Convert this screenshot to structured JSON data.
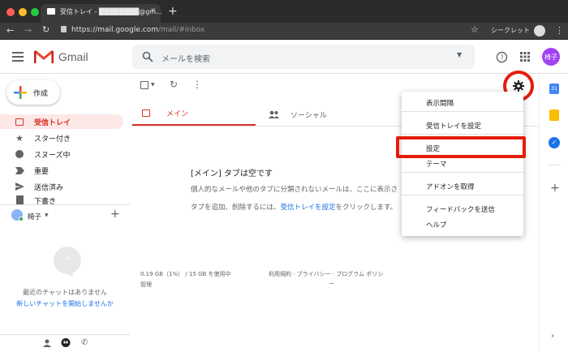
{
  "browser": {
    "tab_title": "受信トレイ - ████████@gm...",
    "new_tab": "+",
    "url_main": "https://mail.google.com",
    "url_path": "/mail/#inbox",
    "incognito_label": "シークレット"
  },
  "header": {
    "app_name": "Gmail",
    "search_placeholder": "メールを検索",
    "avatar_text": "椅子"
  },
  "sidebar": {
    "compose_label": "作成",
    "items": [
      {
        "label": "受信トレイ",
        "icon": "inbox-icon"
      },
      {
        "label": "スター付き",
        "icon": "star-icon"
      },
      {
        "label": "スヌーズ中",
        "icon": "clock-icon"
      },
      {
        "label": "重要",
        "icon": "label-important-icon"
      },
      {
        "label": "送信済み",
        "icon": "send-icon"
      },
      {
        "label": "下書き",
        "icon": "draft-icon"
      }
    ],
    "chat_user": "椅子",
    "chat_add": "+",
    "no_chats": "最近のチャットはありません",
    "start_chat_link": "新しいチャットを開始しませんか"
  },
  "main": {
    "tabs": [
      {
        "label": "メイン"
      },
      {
        "label": "ソーシャル"
      }
    ],
    "empty_title": "[メイン] タブは空です",
    "empty_desc": "個人的なメールや他のタブに分類されないメールは、ここに表示さ",
    "empty_desc2_prefix": "タブを追加、削除するには、",
    "empty_desc2_link": "受信トレイを設定",
    "empty_desc2_suffix": "をクリックします。",
    "storage": "0.19 GB（1%） / 15 GB を使用中",
    "manage": "管理",
    "footer_links": "利用規約 · プライバシー · プログラム ポリシ",
    "footer_dash": "ー"
  },
  "menu": {
    "items": [
      "表示間隔",
      "受信トレイを設定",
      "設定",
      "テーマ",
      "アドオンを取得",
      "フィードバックを送信",
      "ヘルプ"
    ]
  },
  "colors": {
    "accent_red": "#e51c0a",
    "gmail_red": "#d93025",
    "link_blue": "#1a73e8",
    "avatar_purple": "#a142f4"
  }
}
